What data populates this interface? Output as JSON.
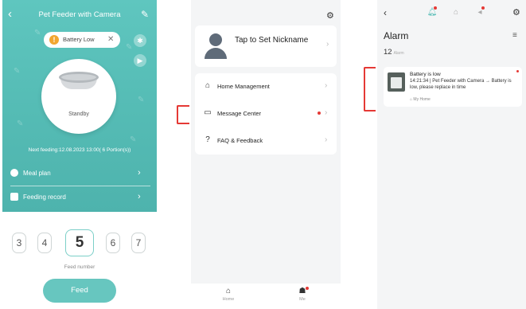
{
  "colors": {
    "teal": "#56bdb6",
    "alert_red": "#e53935",
    "warning_orange": "#f2a630"
  },
  "feeder": {
    "title": "Pet Feeder with Camera",
    "alert_chip": "Battery Low",
    "status": "Standby",
    "next_feeding": "Next feeding:12.08.2023 13:00( 6 Portion(s))",
    "meal_plan": "Meal plan",
    "feeding_record": "Feeding record",
    "picker_numbers": [
      "3",
      "4",
      "5",
      "6",
      "7"
    ],
    "picker_selected": "5",
    "picker_label": "Feed number",
    "feed_button": "Feed",
    "icons": [
      "back-icon",
      "edit-icon",
      "warning-icon",
      "close-icon",
      "settings-icon",
      "camera-icon"
    ]
  },
  "profile": {
    "nickname_prompt": "Tap to Set Nickname",
    "menu": [
      {
        "label": "Home Management",
        "icon": "home-icon"
      },
      {
        "label": "Message Center",
        "icon": "message-icon"
      },
      {
        "label": "FAQ & Feedback",
        "icon": "help-icon"
      }
    ],
    "tabs": [
      {
        "label": "Home",
        "icon": "home-tab-icon"
      },
      {
        "label": "Me",
        "icon": "me-tab-icon"
      }
    ]
  },
  "alarm": {
    "title": "Alarm",
    "count": "12",
    "count_unit": "Alarm",
    "card": {
      "title": "Battery is low",
      "body": "14:21:34 | Pet Feeder with Camera → Battery is low, please replace in time",
      "home": "My Home"
    }
  }
}
